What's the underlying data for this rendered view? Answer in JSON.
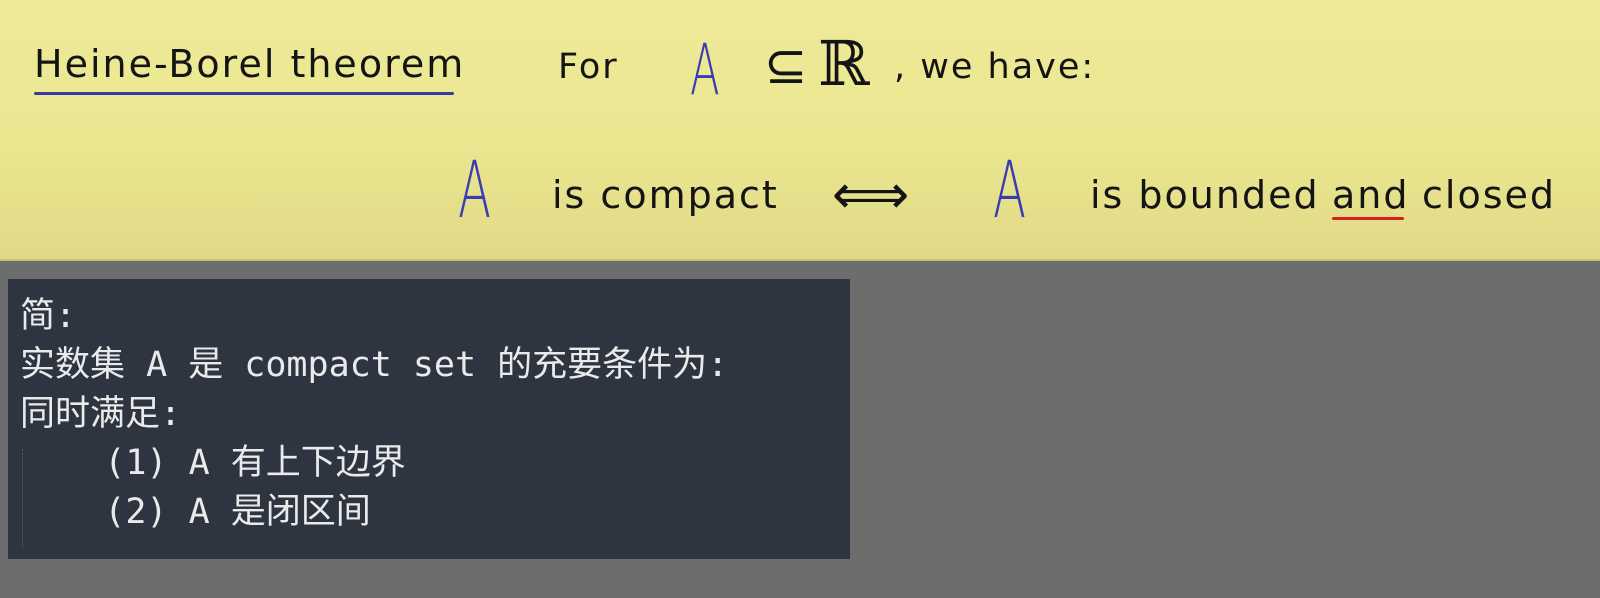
{
  "board": {
    "title": "Heine-Borel theorem",
    "for_label": "For",
    "set_symbol": "A",
    "subset_symbol": "⊆",
    "reals_symbol": "ℝ",
    "we_have": ", we have:",
    "lhs_symbol": "A",
    "is_compact": "is compact",
    "iff_symbol": "⟺",
    "rhs_symbol": "A",
    "is_bounded": "is bounded",
    "and_word": "and",
    "closed_word": "closed"
  },
  "notes": {
    "lines": [
      "简:",
      "实数集 A 是 compact set 的充要条件为:",
      "同时满足:",
      "    (1) A 有上下边界",
      "    (2) A 是闭区间"
    ]
  },
  "colors": {
    "board_bg": "#ebe690",
    "accent_blue": "#3a3bb5",
    "accent_red": "#d32020",
    "panel_bg": "#2e3540",
    "page_bg": "#6d6d6d"
  }
}
